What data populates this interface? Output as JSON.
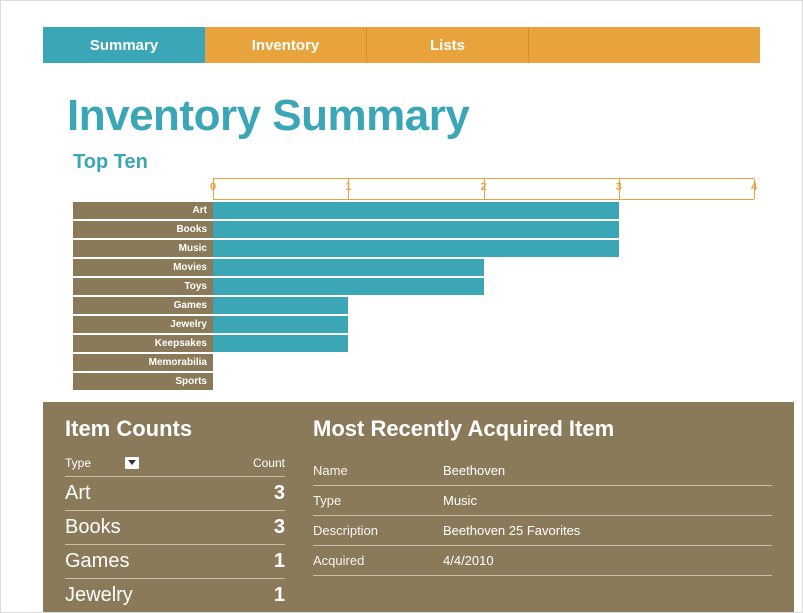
{
  "tabs": [
    "Summary",
    "Inventory",
    "Lists"
  ],
  "title": "Inventory Summary",
  "chart_data": {
    "type": "bar",
    "title": "Top Ten",
    "xlabel": "",
    "ylabel": "",
    "xlim": [
      0,
      4
    ],
    "ticks": [
      0,
      1,
      2,
      3,
      4
    ],
    "categories": [
      "Art",
      "Books",
      "Music",
      "Movies",
      "Toys",
      "Games",
      "Jewelry",
      "Keepsakes",
      "Memorabilia",
      "Sports"
    ],
    "values": [
      3,
      3,
      3,
      2,
      2,
      1,
      1,
      1,
      0,
      0
    ]
  },
  "counts": {
    "title": "Item Counts",
    "columns": [
      "Type",
      "Count"
    ],
    "rows": [
      {
        "type": "Art",
        "count": 3
      },
      {
        "type": "Books",
        "count": 3
      },
      {
        "type": "Games",
        "count": 1
      },
      {
        "type": "Jewelry",
        "count": 1
      }
    ]
  },
  "recent": {
    "title": "Most Recently Acquired Item",
    "fields": [
      {
        "key": "Name",
        "value": "Beethoven"
      },
      {
        "key": "Type",
        "value": "Music"
      },
      {
        "key": "Description",
        "value": "Beethoven 25 Favorites"
      },
      {
        "key": "Acquired",
        "value": "4/4/2010"
      }
    ]
  }
}
